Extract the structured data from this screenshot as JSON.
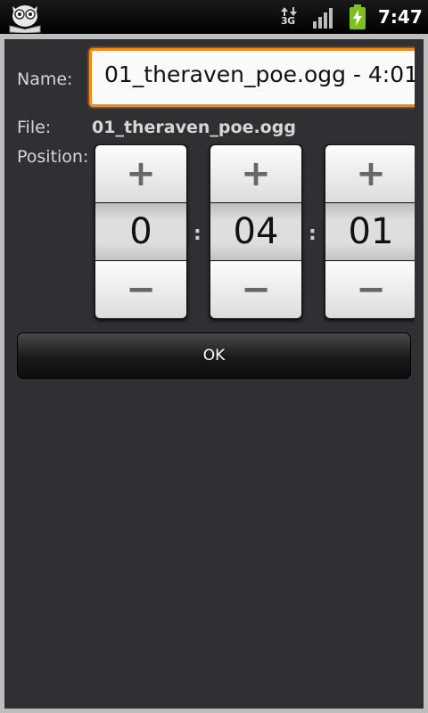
{
  "status_bar": {
    "network_label": "3G",
    "time": "7:47",
    "app_icon": "owl-book-icon",
    "icons": [
      "data-arrows-icon",
      "signal-bars-icon",
      "battery-charging-icon"
    ]
  },
  "dialog": {
    "name_label": "Name:",
    "name_value": "01_theraven_poe.ogg - 4:01",
    "file_label": "File:",
    "file_value": "01_theraven_poe.ogg",
    "position_label": "Position:",
    "pickers": [
      {
        "plus": "+",
        "value": "0",
        "minus": "−"
      },
      {
        "plus": "+",
        "value": "04",
        "minus": "−"
      },
      {
        "plus": "+",
        "value": "01",
        "minus": "−"
      }
    ],
    "separator": ":",
    "ok_label": "OK"
  },
  "colors": {
    "accent_focus": "#f08a15",
    "panel_background": "#302f33"
  }
}
